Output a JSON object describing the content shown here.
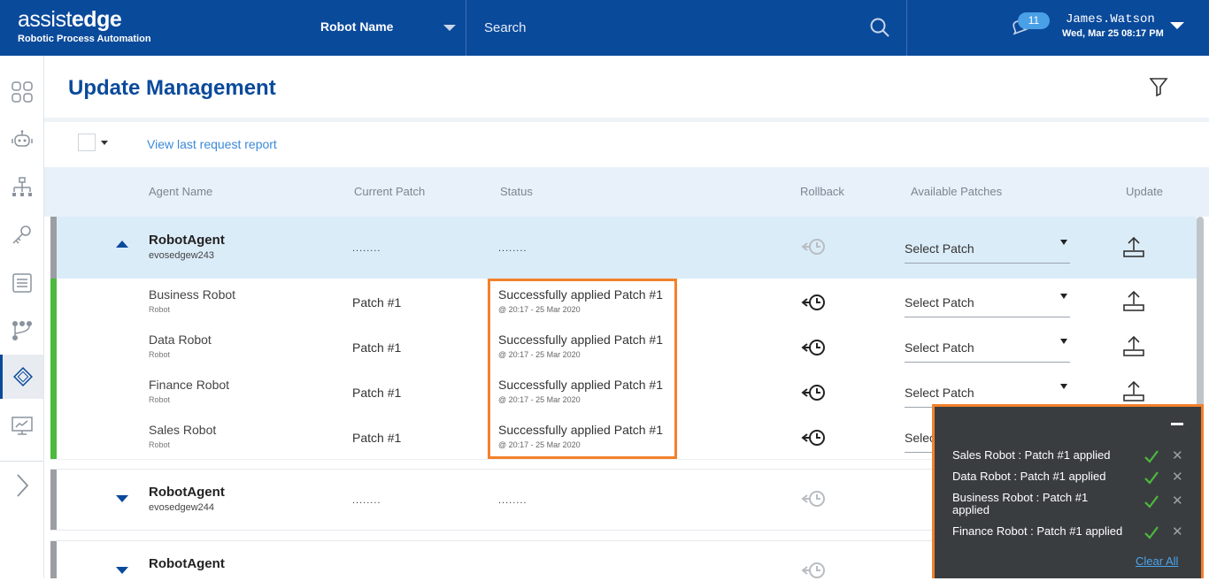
{
  "header": {
    "logo_left": "assist",
    "logo_right": "edge",
    "logo_sub": "Robotic Process Automation",
    "robot_select": "Robot Name",
    "search_placeholder": "Search",
    "notif_count": "11",
    "user_name": "James.Watson",
    "user_datetime": "Wed, Mar 25 08:17 PM"
  },
  "sidebar": {
    "items": [
      "dashboard-icon",
      "robot-icon",
      "hierarchy-icon",
      "key-icon",
      "list-icon",
      "workflow-icon",
      "chip-icon",
      "monitor-chart-icon"
    ],
    "active": "chip-icon"
  },
  "page": {
    "title": "Update Management",
    "report_link": "View last request report"
  },
  "table": {
    "headers": {
      "agent": "Agent Name",
      "patch": "Current Patch",
      "status": "Status",
      "rollback": "Rollback",
      "available": "Available Patches",
      "update": "Update"
    },
    "groups": [
      {
        "title": "RobotAgent",
        "host": "evosedgew243",
        "patch": "........",
        "status": "........",
        "select": "Select Patch",
        "expanded": true,
        "children": [
          {
            "name": "Business Robot",
            "type": "Robot",
            "patch": "Patch #1",
            "status": "Successfully applied Patch #1",
            "time": "@ 20:17 - 25 Mar 2020",
            "select": "Select Patch"
          },
          {
            "name": "Data Robot",
            "type": "Robot",
            "patch": "Patch #1",
            "status": "Successfully applied Patch #1",
            "time": "@ 20:17 - 25 Mar 2020",
            "select": "Select Patch"
          },
          {
            "name": "Finance Robot",
            "type": "Robot",
            "patch": "Patch #1",
            "status": "Successfully applied Patch #1",
            "time": "@ 20:17 - 25 Mar 2020",
            "select": "Select Patch"
          },
          {
            "name": "Sales Robot",
            "type": "Robot",
            "patch": "Patch #1",
            "status": "Successfully applied Patch #1",
            "time": "@ 20:17 - 25 Mar 2020",
            "select": "Select Patch"
          }
        ]
      },
      {
        "title": "RobotAgent",
        "host": "evosedgew244",
        "patch": "........",
        "status": "........",
        "select": "Select Patch",
        "expanded": false
      },
      {
        "title": "RobotAgent",
        "select": "Select Patch",
        "expanded": false
      }
    ]
  },
  "notifications": {
    "items": [
      "Sales Robot : Patch #1 applied",
      "Data Robot : Patch #1 applied",
      "Business Robot : Patch #1 applied",
      "Finance Robot : Patch #1 applied"
    ],
    "clear_all": "Clear All"
  },
  "colors": {
    "brand_blue": "#0a4a9b",
    "success_green": "#4cba3c",
    "highlight_orange": "#f2812b",
    "link_blue": "#3c8ad8"
  }
}
